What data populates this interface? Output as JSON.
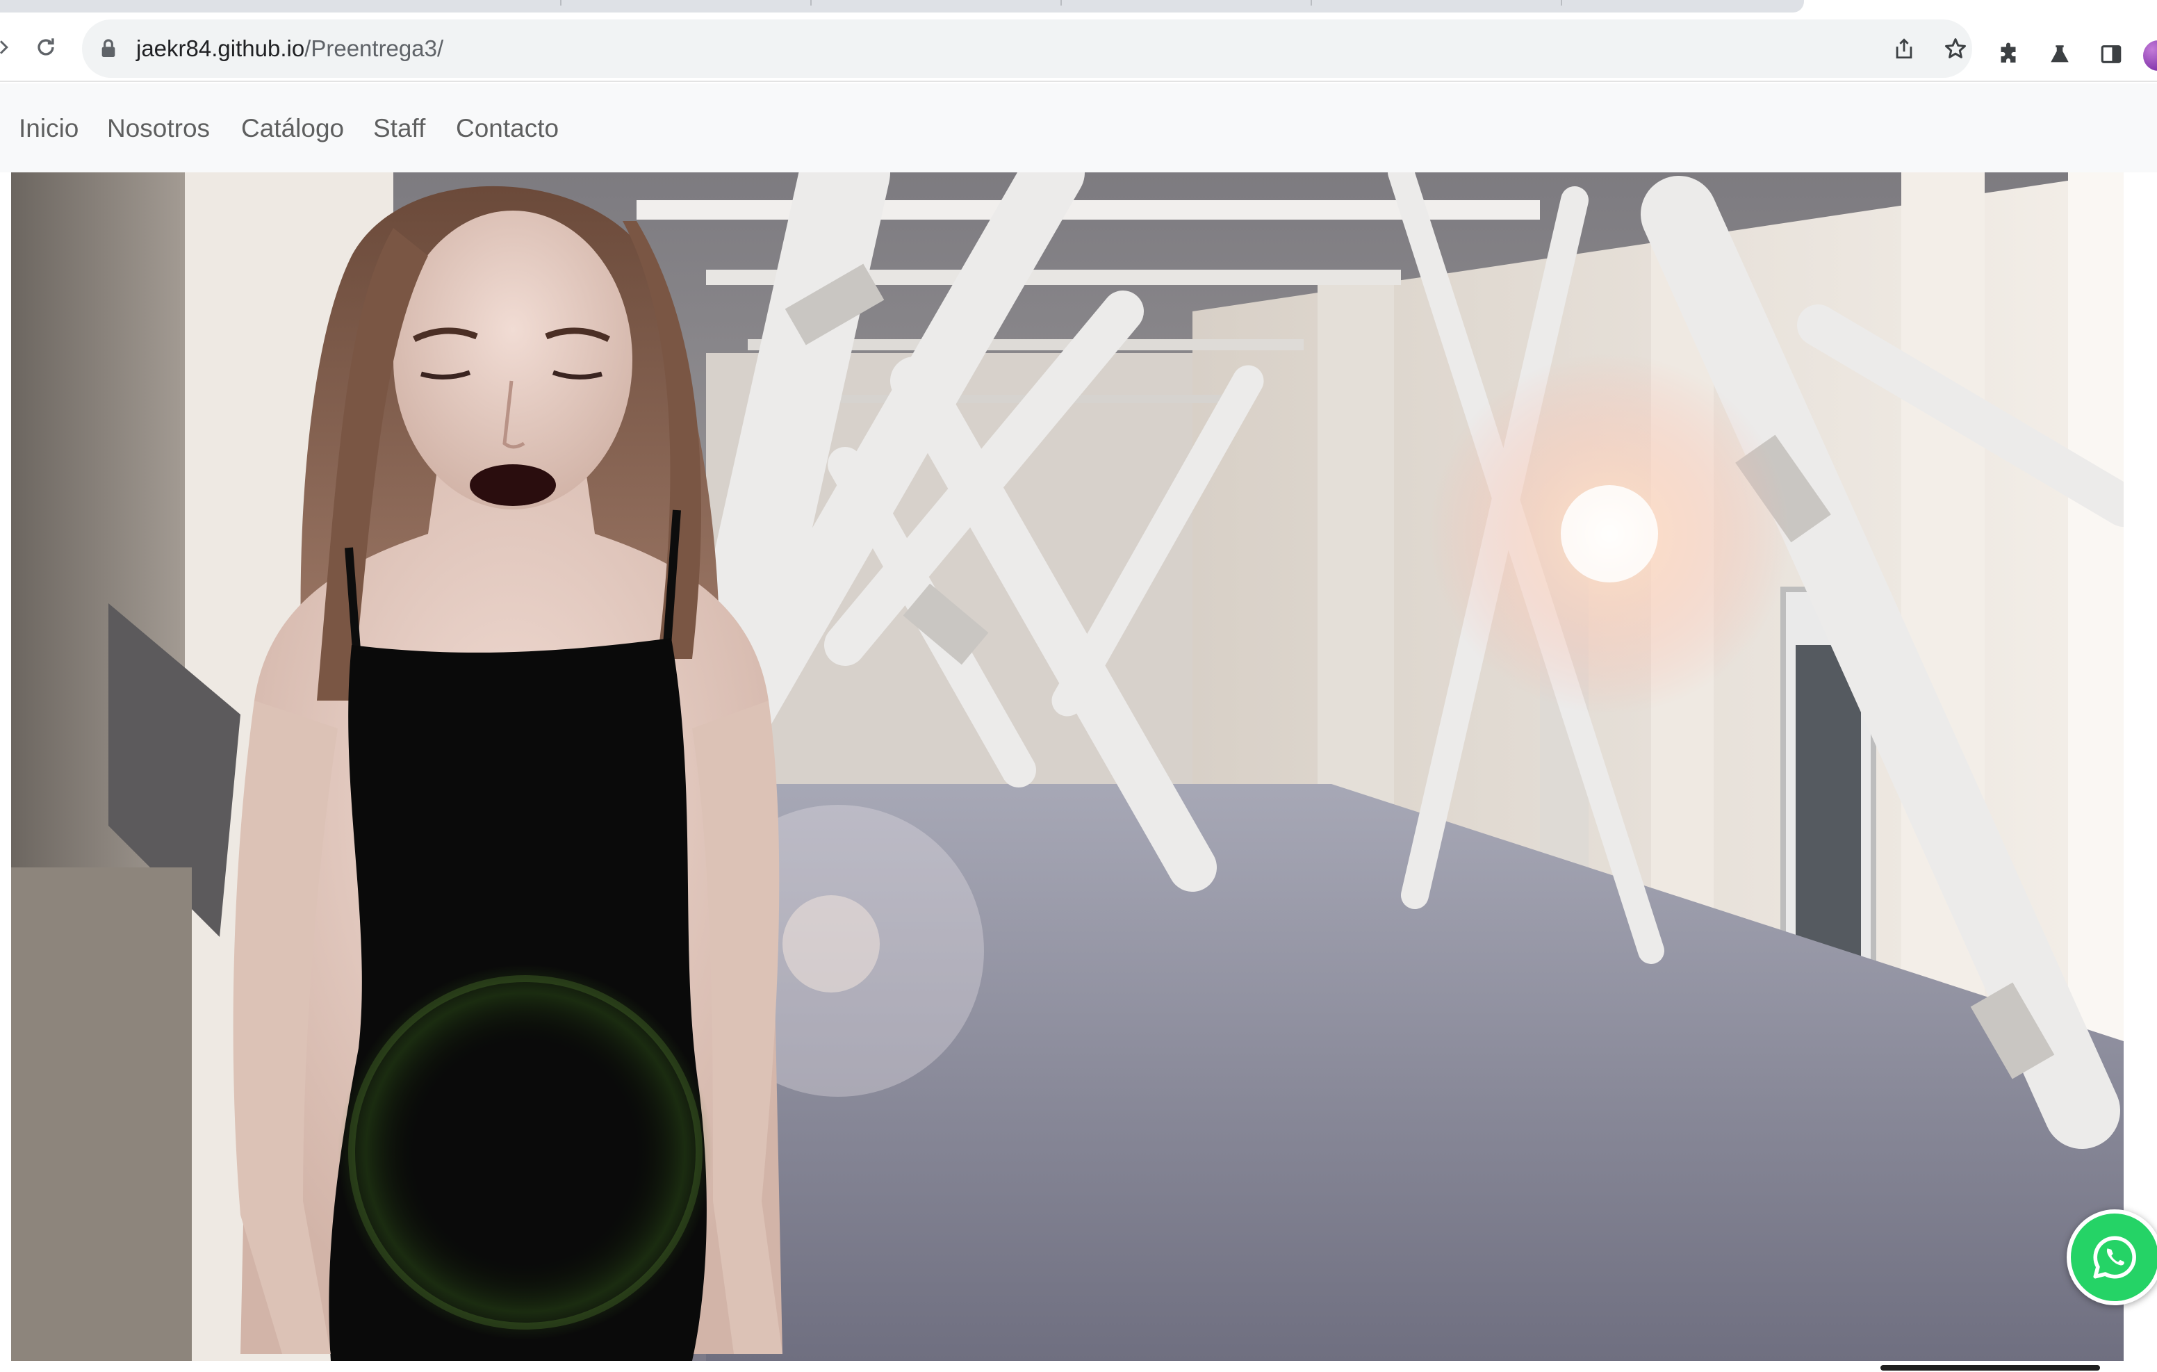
{
  "browser": {
    "url_host": "jaekr84.github.io",
    "url_path": "/Preentrega3/"
  },
  "navbar": {
    "links": [
      "Inicio",
      "Nosotros",
      "Catálogo",
      "Staff",
      "Contacto"
    ]
  },
  "hero": {
    "image": "fashion-model-black-dress-industrial-corridor"
  },
  "floating": {
    "whatsapp_icon": "whatsapp-icon",
    "whatsapp_color": "#25d366"
  },
  "colors": {
    "navbar_bg": "#f8f9fa",
    "nav_link": "rgba(0,0,0,0.62)",
    "omnibox_bg": "#f1f3f4"
  }
}
